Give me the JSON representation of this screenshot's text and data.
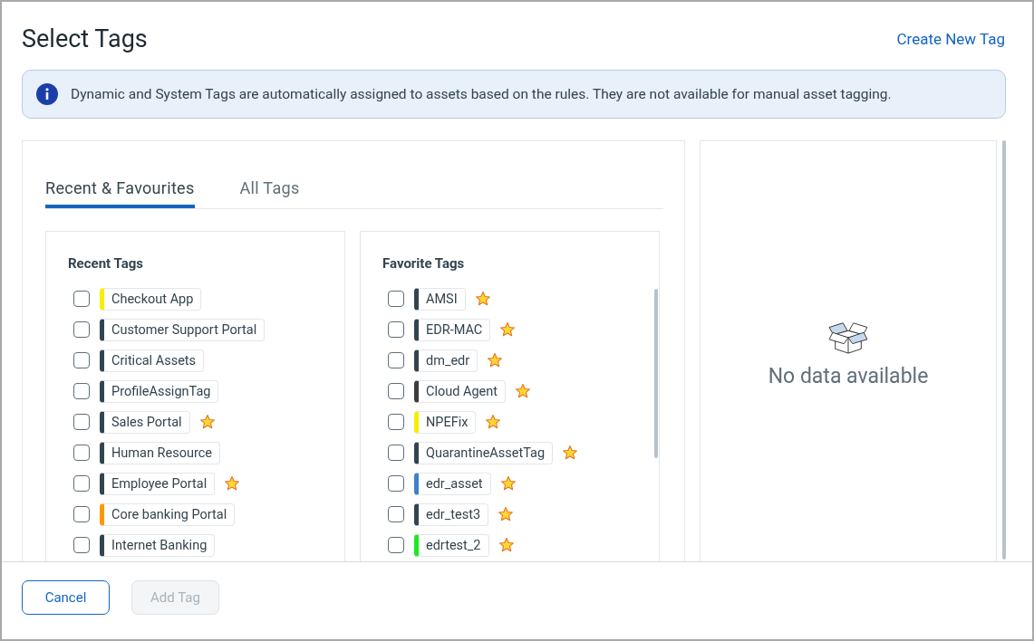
{
  "dialog": {
    "title": "Select Tags",
    "create_link": "Create New Tag"
  },
  "info_banner": {
    "text": "Dynamic and System Tags are automatically assigned to assets based on the rules. They are not available for manual asset tagging."
  },
  "tabs": [
    {
      "label": "Recent & Favourites",
      "selected": true
    },
    {
      "label": "All Tags",
      "selected": false
    }
  ],
  "recent_tags": {
    "title": "Recent Tags",
    "items": [
      {
        "label": "Checkout App",
        "color": "#f5f000",
        "checked": false,
        "favorite": false
      },
      {
        "label": "Customer Support Portal",
        "color": "#33444f",
        "checked": false,
        "favorite": false
      },
      {
        "label": "Critical Assets",
        "color": "#33444f",
        "checked": false,
        "favorite": false
      },
      {
        "label": "ProfileAssignTag",
        "color": "#33444f",
        "checked": false,
        "favorite": false
      },
      {
        "label": "Sales Portal",
        "color": "#33444f",
        "checked": false,
        "favorite": true
      },
      {
        "label": "Human Resource",
        "color": "#33444f",
        "checked": false,
        "favorite": false
      },
      {
        "label": "Employee Portal",
        "color": "#33444f",
        "checked": false,
        "favorite": true
      },
      {
        "label": "Core banking Portal",
        "color": "#ff9800",
        "checked": false,
        "favorite": false
      },
      {
        "label": "Internet Banking",
        "color": "#33444f",
        "checked": false,
        "favorite": false
      }
    ]
  },
  "favorite_tags": {
    "title": "Favorite Tags",
    "items": [
      {
        "label": "AMSI",
        "color": "#33444f",
        "checked": false,
        "favorite": true
      },
      {
        "label": "EDR-MAC",
        "color": "#33444f",
        "checked": false,
        "favorite": true
      },
      {
        "label": "dm_edr",
        "color": "#33444f",
        "checked": false,
        "favorite": true
      },
      {
        "label": "Cloud Agent",
        "color": "#3d3d3d",
        "checked": false,
        "favorite": true
      },
      {
        "label": "NPEFix",
        "color": "#f5f000",
        "checked": false,
        "favorite": true
      },
      {
        "label": "QuarantineAssetTag",
        "color": "#33444f",
        "checked": false,
        "favorite": true
      },
      {
        "label": "edr_asset",
        "color": "#3f80c8",
        "checked": false,
        "favorite": true
      },
      {
        "label": "edr_test3",
        "color": "#33444f",
        "checked": false,
        "favorite": true
      },
      {
        "label": "edrtest_2",
        "color": "#1ee81e",
        "checked": false,
        "favorite": true
      }
    ]
  },
  "details_panel": {
    "empty_text": "No data available"
  },
  "buttons": [
    {
      "label": "Cancel",
      "kind": "secondary",
      "disabled": false
    },
    {
      "label": "Add Tag",
      "kind": "primary",
      "disabled": true
    }
  ]
}
